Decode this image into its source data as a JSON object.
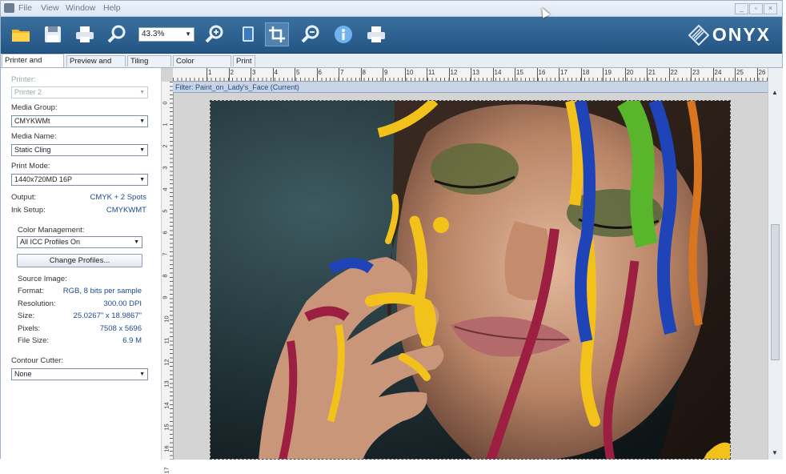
{
  "menu": [
    "File",
    "View",
    "Window",
    "Help"
  ],
  "window_controls": [
    "_",
    "▫",
    "×"
  ],
  "toolbar": {
    "zoom_value": "43.3%",
    "buttons": [
      "open-folder-icon",
      "save-icon",
      "print-icon",
      "zoom-icon",
      "zoom-in-icon",
      "media-icon",
      "crop-icon",
      "zoom-out-icon",
      "info-icon",
      "printer-queue-icon"
    ],
    "brand": "ONYX"
  },
  "tabs": [
    "Printer and Media",
    "Preview and Size",
    "Tiling Setup",
    "Color Correction",
    "Print"
  ],
  "selected_tab": 0,
  "panel": {
    "printer_label": "Printer:",
    "printer_value": "Printer 2",
    "media_group_label": "Media Group:",
    "media_group_value": "CMYKWMt",
    "media_name_label": "Media Name:",
    "media_name_value": "Static Cling",
    "print_mode_label": "Print Mode:",
    "print_mode_value": "1440x720MD 16P",
    "output_label": "Output:",
    "output_value": "CMYK + 2 Spots",
    "ink_setup_label": "Ink Setup:",
    "ink_setup_value": "CMYKWMT",
    "color_mgmt_label": "Color Management:",
    "color_mgmt_value": "All ICC Profiles On",
    "change_profiles": "Change Profiles...",
    "source_image_label": "Source Image:",
    "format_label": "Format:",
    "format_value": "RGB, 8 bits per sample",
    "resolution_label": "Resolution:",
    "resolution_value": "300.00 DPI",
    "size_label": "Size:",
    "size_value": "25.0267\" x 18.9867\"",
    "pixels_label": "Pixels:",
    "pixels_value": "7508 x 5696",
    "file_size_label": "File Size:",
    "file_size_value": "6.9 M",
    "contour_label": "Contour Cutter:",
    "contour_value": "None"
  },
  "canvas": {
    "filter_text": "Filter: Paint_on_Lady's_Face (Current)",
    "hruler": [
      "1",
      "2",
      "3",
      "4",
      "5",
      "6",
      "7",
      "8",
      "9",
      "10",
      "11",
      "12",
      "13",
      "14",
      "15",
      "16",
      "17",
      "18",
      "19",
      "20",
      "21",
      "22",
      "23",
      "24",
      "25",
      "26"
    ],
    "vruler": [
      "0",
      "1",
      "2",
      "3",
      "4",
      "5",
      "6",
      "7",
      "8",
      "9",
      "10",
      "11",
      "12",
      "13",
      "14",
      "15",
      "16",
      "17"
    ]
  },
  "colors": {
    "toolbar": "#2f6393",
    "paint_yellow": "#f2c21a",
    "paint_blue": "#1f44b8",
    "paint_green": "#59b62c",
    "paint_red": "#9c1f42",
    "paint_orange": "#d9751e"
  }
}
